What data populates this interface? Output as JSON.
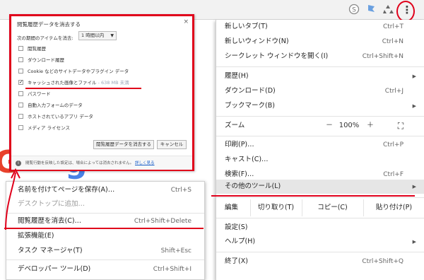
{
  "toolbar": {
    "icons": [
      "skype-icon",
      "bookmark-flag-icon",
      "recycle-icon"
    ],
    "menu_glyph": "⋮"
  },
  "page": {
    "logo_letters": [
      "G",
      "g"
    ]
  },
  "dialog": {
    "title": "閲覧履歴データを消去する",
    "close_glyph": "×",
    "period_label": "次の期間のアイテムを消去:",
    "period_value": "1 時間以内",
    "options": [
      {
        "label": "閲覧履歴",
        "checked": false
      },
      {
        "label": "ダウンロード履歴",
        "checked": false
      },
      {
        "label": "Cookie などのサイトデータやプラグイン データ",
        "checked": false
      },
      {
        "label": "キャッシュされた画像とファイル",
        "extra": "- 638 MB 未満",
        "checked": true
      },
      {
        "label": "パスワード",
        "checked": false
      },
      {
        "label": "自動入力フォームのデータ",
        "checked": false
      },
      {
        "label": "ホストされているアプリ データ",
        "checked": false
      },
      {
        "label": "メディア ライセンス",
        "checked": false
      }
    ],
    "clear_button": "閲覧履歴データを消去する",
    "cancel_button": "キャンセル",
    "footer_text": "閲覧行動を反映した設定は、場合によっては消去されません。",
    "footer_link": "詳しく見る"
  },
  "menu": {
    "items_top": [
      {
        "label": "新しいタブ(T)",
        "shortcut": "Ctrl+T"
      },
      {
        "label": "新しいウィンドウ(N)",
        "shortcut": "Ctrl+N"
      },
      {
        "label": "シークレット ウィンドウを開く(I)",
        "shortcut": "Ctrl+Shift+N"
      }
    ],
    "items_mid": [
      {
        "label": "履歴(H)",
        "shortcut": "",
        "arrow": "▶"
      },
      {
        "label": "ダウンロード(D)",
        "shortcut": "Ctrl+J"
      },
      {
        "label": "ブックマーク(B)",
        "shortcut": "",
        "arrow": "▶"
      }
    ],
    "zoom": {
      "label": "ズーム",
      "minus": "－",
      "value": "100%",
      "plus": "＋",
      "fullscreen_glyph": "⛶"
    },
    "items_print": [
      {
        "label": "印刷(P)…",
        "shortcut": "Ctrl+P"
      },
      {
        "label": "キャスト(C)…",
        "shortcut": ""
      },
      {
        "label": "検索(F)…",
        "shortcut": "Ctrl+F"
      },
      {
        "label": "その他のツール(L)",
        "shortcut": "",
        "arrow": "▶"
      }
    ],
    "edit": {
      "label": "編集",
      "cut": "切り取り(T)",
      "copy": "コピー(C)",
      "paste": "貼り付け(P)"
    },
    "items_bottom": [
      {
        "label": "設定(S)",
        "shortcut": ""
      },
      {
        "label": "ヘルプ(H)",
        "shortcut": "",
        "arrow": "▶"
      }
    ],
    "exit": {
      "label": "終了(X)",
      "shortcut": "Ctrl+Shift+Q"
    }
  },
  "submenu": {
    "items": [
      {
        "label": "名前を付けてページを保存(A)…",
        "shortcut": "Ctrl+S"
      },
      {
        "label": "デスクトップに追加…",
        "shortcut": ""
      },
      {
        "label": "閲覧履歴を消去(C)…",
        "shortcut": "Ctrl+Shift+Delete"
      },
      {
        "label": "拡張機能(E)",
        "shortcut": ""
      },
      {
        "label": "タスク マネージャ(T)",
        "shortcut": "Shift+Esc"
      },
      {
        "label": "デベロッパー ツール(D)",
        "shortcut": "Ctrl+Shift+I"
      }
    ]
  },
  "colors": {
    "annotation_red": "#e0001b",
    "link_blue": "#1a5fc9",
    "highlight": "#e6e6e6"
  }
}
